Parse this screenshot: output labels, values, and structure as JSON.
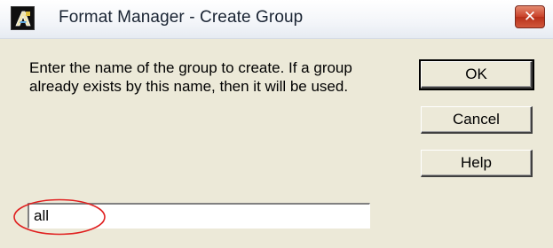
{
  "window": {
    "title": "Format Manager - Create Group",
    "close_icon": "close-icon"
  },
  "message": {
    "text": "Enter the name of the group to create.  If a group already exists by this name, then it will be used."
  },
  "buttons": {
    "ok_label": "OK",
    "cancel_label": "Cancel",
    "help_label": "Help"
  },
  "group_name_input": {
    "value": "all"
  },
  "annotation": {
    "ellipse_color": "#e02020"
  },
  "colors": {
    "dialog_bg": "#ece9d8",
    "close_button": "#c9412a"
  }
}
